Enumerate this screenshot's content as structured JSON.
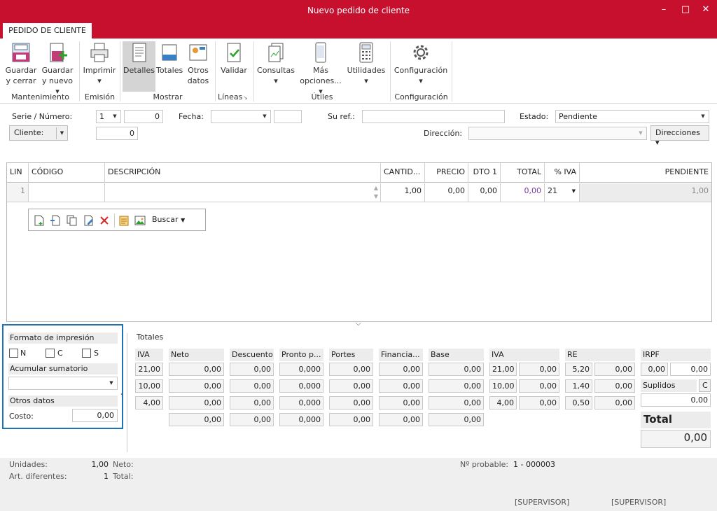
{
  "window": {
    "title": "Nuevo pedido de cliente"
  },
  "tab": {
    "label": "PEDIDO DE CLIENTE"
  },
  "ribbon": {
    "guardar_cerrar": [
      "Guardar",
      "y cerrar"
    ],
    "guardar_nuevo": [
      "Guardar",
      "y nuevo ▾"
    ],
    "imprimir": [
      "Imprimir",
      "▾"
    ],
    "detalles": "Detalles",
    "totales": "Totales",
    "otros_datos": [
      "Otros",
      "datos"
    ],
    "validar": "Validar",
    "consultas": [
      "Consultas",
      "▾"
    ],
    "mas_opciones": [
      "Más",
      "opciones... ▾"
    ],
    "utilidades": [
      "Utilidades",
      "▾"
    ],
    "configuracion": [
      "Configuración",
      "▾"
    ],
    "groups": {
      "mantenimiento": "Mantenimiento",
      "emision": "Emisión",
      "mostrar": "Mostrar",
      "lineas": "Líneas",
      "utiles": "Útiles",
      "configuracion": "Configuración"
    }
  },
  "form": {
    "serie_label": "Serie / Número:",
    "serie_value": "1",
    "numero_value": "0",
    "fecha_label": "Fecha:",
    "fecha_value": "",
    "suref_label": "Su ref.:",
    "suref_value": "",
    "estado_label": "Estado:",
    "estado_value": "Pendiente",
    "cliente_label": "Cliente:",
    "cliente_value": "0",
    "direccion_label": "Dirección:",
    "direccion_value": "",
    "direcciones_button": "Direcciones ▾"
  },
  "grid": {
    "columns": [
      "LIN",
      "CÓDIGO",
      "DESCRIPCIÓN",
      "CANTID...",
      "PRECIO",
      "DTO 1",
      "TOTAL",
      "% IVA",
      "PENDIENTE"
    ],
    "rows": [
      {
        "lin": "1",
        "codigo": "",
        "descripcion": "",
        "cantidad": "1,00",
        "precio": "0,00",
        "dto1": "0,00",
        "total": "0,00",
        "iva": "21",
        "pendiente": "1,00"
      }
    ],
    "toolbar": {
      "buscar": "Buscar"
    }
  },
  "format_panel": {
    "title": "Formato de impresión",
    "checkboxes": [
      "N",
      "C",
      "S"
    ],
    "acumular": "Acumular sumatorio",
    "acumular_value": "",
    "otros": "Otros datos",
    "costo_label": "Costo:",
    "costo_value": "0,00"
  },
  "totals": {
    "title": "Totales",
    "headers": {
      "iva": "IVA",
      "neto": "Neto",
      "descuento": "Descuento",
      "pronto": "Pronto p...",
      "portes": "Portes",
      "financia": "Financia...",
      "base": "Base",
      "iva2": "IVA",
      "re": "RE",
      "irpf": "IRPF"
    },
    "rows": [
      {
        "iva": "21,00",
        "neto": "0,00",
        "descuento": "0,00",
        "pronto": "0,000",
        "portes": "0,00",
        "financia": "0,00",
        "base": "0,00",
        "ivap": "21,00",
        "ivav": "0,00",
        "rep": "5,20",
        "rev": "0,00"
      },
      {
        "iva": "10,00",
        "neto": "0,00",
        "descuento": "0,00",
        "pronto": "0,000",
        "portes": "0,00",
        "financia": "0,00",
        "base": "0,00",
        "ivap": "10,00",
        "ivav": "0,00",
        "rep": "1,40",
        "rev": "0,00"
      },
      {
        "iva": "4,00",
        "neto": "0,00",
        "descuento": "0,00",
        "pronto": "0,000",
        "portes": "0,00",
        "financia": "0,00",
        "base": "0,00",
        "ivap": "4,00",
        "ivav": "0,00",
        "rep": "0,50",
        "rev": "0,00"
      }
    ],
    "sum": {
      "neto": "0,00",
      "descuento": "0,00",
      "pronto": "0,000",
      "portes": "0,00",
      "financia": "0,00",
      "base": "0,00"
    },
    "irpf_p": "0,00",
    "irpf_v": "0,00",
    "suplidos_label": "Suplidos",
    "suplidos_btn": "C",
    "suplidos_value": "0,00",
    "total_label": "Total",
    "total_value": "0,00"
  },
  "status": {
    "unidades_label": "Unidades:",
    "unidades_value": "1,00",
    "art_label": "Art. diferentes:",
    "art_value": "1",
    "neto_label": "Neto:",
    "total_label": "Total:",
    "nprob_label": "Nº probable:",
    "nprob_value": "1 - 000003",
    "user1": "[SUPERVISOR]",
    "user2": "[SUPERVISOR]"
  }
}
